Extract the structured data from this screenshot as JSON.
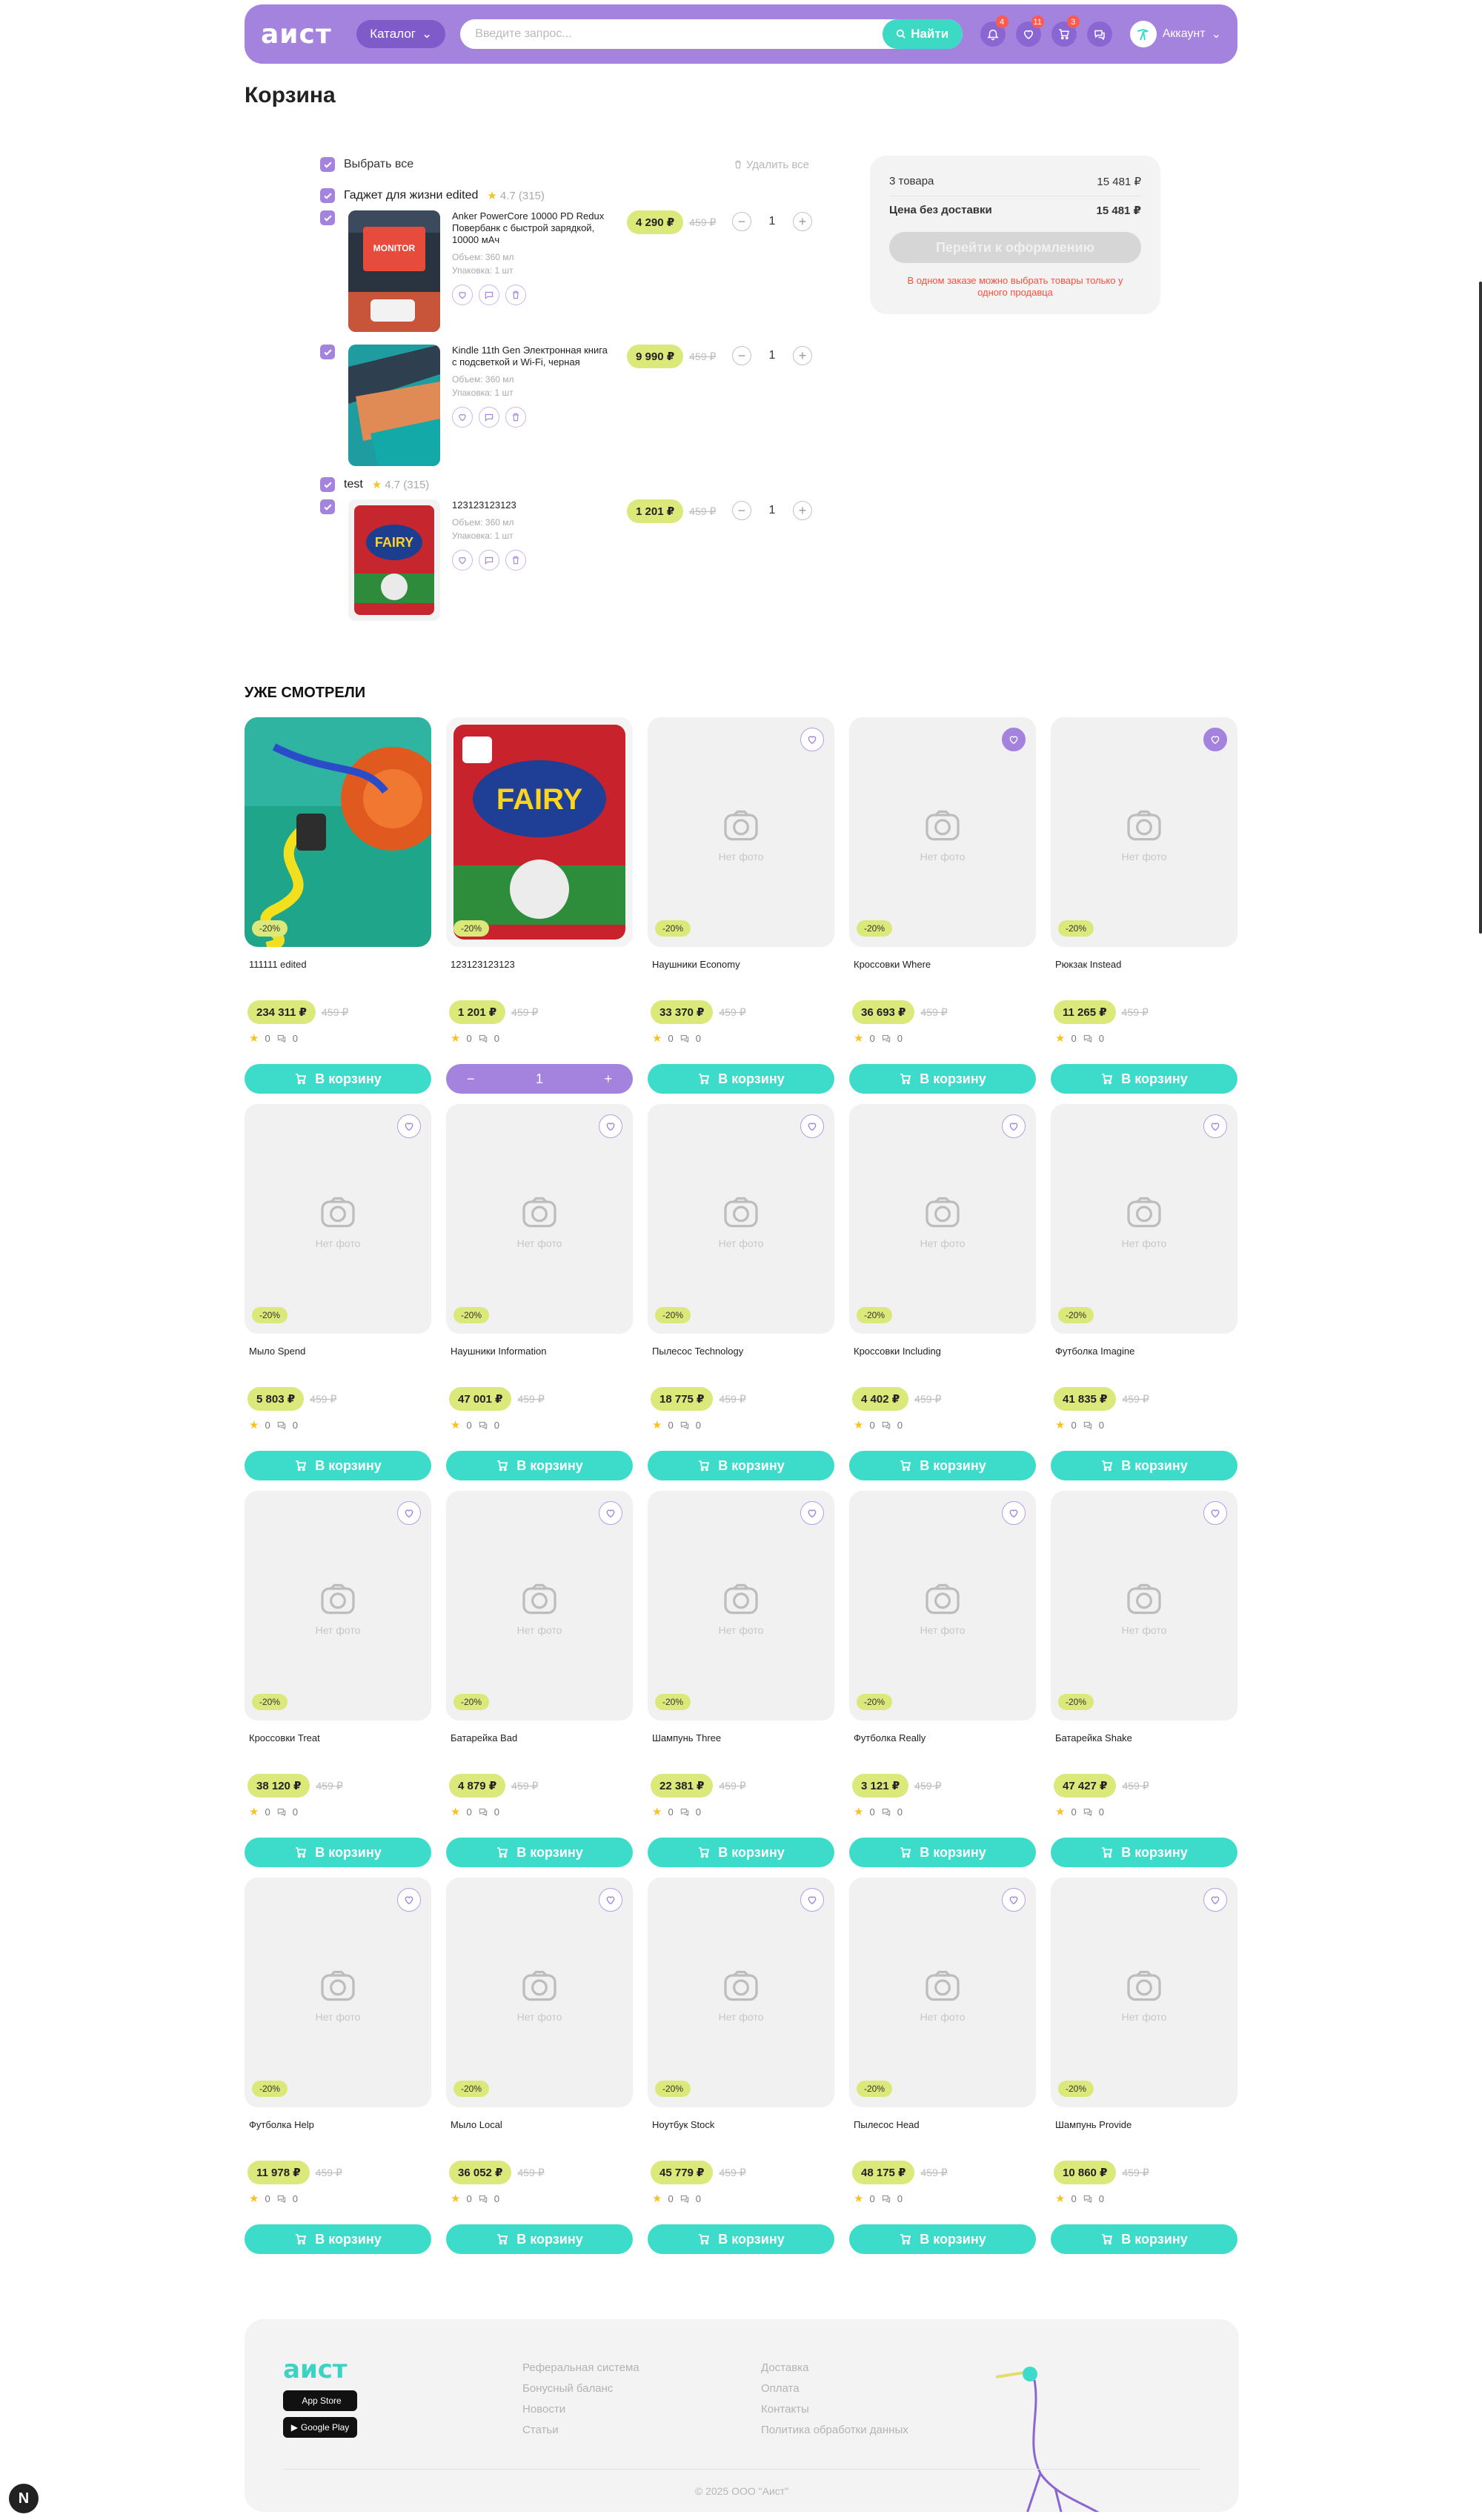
{
  "header": {
    "logo": "аист",
    "catalog": "Каталог",
    "search_placeholder": "Введите запрос...",
    "search_button": "Найти",
    "badges": {
      "notifications": "4",
      "favorites": "11",
      "cart": "3"
    },
    "account": "Аккаунт"
  },
  "page_title": "Корзина",
  "cart": {
    "select_all": "Выбрать все",
    "delete_all": "Удалить все",
    "sellers": [
      {
        "name": "Гаджет для жизни edited",
        "rating": "4.7 (315)",
        "items": [
          {
            "name": "Anker PowerCore 10000 PD Redux Повербанк с быстрой зарядкой, 10000 мАч",
            "volume": "Объем: 360 мл",
            "package": "Упаковка: 1 шт",
            "price": "4 290 ₽",
            "old_price": "459 ₽",
            "qty": "1"
          },
          {
            "name": "Kindle 11th Gen Электронная книга с подсветкой и Wi-Fi, черная",
            "volume": "Объем: 360 мл",
            "package": "Упаковка: 1 шт",
            "price": "9 990 ₽",
            "old_price": "459 ₽",
            "qty": "1"
          }
        ]
      },
      {
        "name": "test",
        "rating": "4.7 (315)",
        "items": [
          {
            "name": "123123123123",
            "volume": "Объем: 360 мл",
            "package": "Упаковка: 1 шт",
            "price": "1 201 ₽",
            "old_price": "459 ₽",
            "qty": "1"
          }
        ]
      }
    ]
  },
  "summary": {
    "items_label": "3 товара",
    "items_total": "15 481 ₽",
    "no_delivery_label": "Цена без доставки",
    "no_delivery_total": "15 481 ₽",
    "checkout": "Перейти к оформлению",
    "warning": "В одном заказе можно выбрать товары только у одного продавца"
  },
  "viewed_title": "УЖЕ СМОТРЕЛИ",
  "viewed": [
    {
      "name": "111111 edited",
      "price": "234 311 ₽",
      "old": "459 ₽",
      "disc": "-20%",
      "rating": "0",
      "reviews": "0",
      "img": "compressor",
      "fav": false,
      "in_cart": false
    },
    {
      "name": "123123123123",
      "price": "1 201 ₽",
      "old": "459 ₽",
      "disc": "-20%",
      "rating": "0",
      "reviews": "0",
      "img": "fairy",
      "fav": false,
      "in_cart": true,
      "qty": "1"
    },
    {
      "name": "Наушники Economy",
      "price": "33 370 ₽",
      "old": "459 ₽",
      "disc": "-20%",
      "rating": "0",
      "reviews": "0",
      "img": "none",
      "fav": false,
      "in_cart": false
    },
    {
      "name": "Кроссовки Where",
      "price": "36 693 ₽",
      "old": "459 ₽",
      "disc": "-20%",
      "rating": "0",
      "reviews": "0",
      "img": "none",
      "fav": true,
      "in_cart": false
    },
    {
      "name": "Рюкзак Instead",
      "price": "11 265 ₽",
      "old": "459 ₽",
      "disc": "-20%",
      "rating": "0",
      "reviews": "0",
      "img": "none",
      "fav": true,
      "in_cart": false
    },
    {
      "name": "Мыло Spend",
      "price": "5 803 ₽",
      "old": "459 ₽",
      "disc": "-20%",
      "rating": "0",
      "reviews": "0",
      "img": "none",
      "fav": false,
      "in_cart": false
    },
    {
      "name": "Наушники Information",
      "price": "47 001 ₽",
      "old": "459 ₽",
      "disc": "-20%",
      "rating": "0",
      "reviews": "0",
      "img": "none",
      "fav": false,
      "in_cart": false
    },
    {
      "name": "Пылесос Technology",
      "price": "18 775 ₽",
      "old": "459 ₽",
      "disc": "-20%",
      "rating": "0",
      "reviews": "0",
      "img": "none",
      "fav": false,
      "in_cart": false
    },
    {
      "name": "Кроссовки Including",
      "price": "4 402 ₽",
      "old": "459 ₽",
      "disc": "-20%",
      "rating": "0",
      "reviews": "0",
      "img": "none",
      "fav": false,
      "in_cart": false
    },
    {
      "name": "Футболка Imagine",
      "price": "41 835 ₽",
      "old": "459 ₽",
      "disc": "-20%",
      "rating": "0",
      "reviews": "0",
      "img": "none",
      "fav": false,
      "in_cart": false
    },
    {
      "name": "Кроссовки Treat",
      "price": "38 120 ₽",
      "old": "459 ₽",
      "disc": "-20%",
      "rating": "0",
      "reviews": "0",
      "img": "none",
      "fav": false,
      "in_cart": false
    },
    {
      "name": "Батарейка Bad",
      "price": "4 879 ₽",
      "old": "459 ₽",
      "disc": "-20%",
      "rating": "0",
      "reviews": "0",
      "img": "none",
      "fav": false,
      "in_cart": false
    },
    {
      "name": "Шампунь Three",
      "price": "22 381 ₽",
      "old": "459 ₽",
      "disc": "-20%",
      "rating": "0",
      "reviews": "0",
      "img": "none",
      "fav": false,
      "in_cart": false
    },
    {
      "name": "Футболка Really",
      "price": "3 121 ₽",
      "old": "459 ₽",
      "disc": "-20%",
      "rating": "0",
      "reviews": "0",
      "img": "none",
      "fav": false,
      "in_cart": false
    },
    {
      "name": "Батарейка Shake",
      "price": "47 427 ₽",
      "old": "459 ₽",
      "disc": "-20%",
      "rating": "0",
      "reviews": "0",
      "img": "none",
      "fav": false,
      "in_cart": false
    },
    {
      "name": "Футболка Help",
      "price": "11 978 ₽",
      "old": "459 ₽",
      "disc": "-20%",
      "rating": "0",
      "reviews": "0",
      "img": "none",
      "fav": false,
      "in_cart": false
    },
    {
      "name": "Мыло Local",
      "price": "36 052 ₽",
      "old": "459 ₽",
      "disc": "-20%",
      "rating": "0",
      "reviews": "0",
      "img": "none",
      "fav": false,
      "in_cart": false
    },
    {
      "name": "Ноутбук Stock",
      "price": "45 779 ₽",
      "old": "459 ₽",
      "disc": "-20%",
      "rating": "0",
      "reviews": "0",
      "img": "none",
      "fav": false,
      "in_cart": false
    },
    {
      "name": "Пылесос Head",
      "price": "48 175 ₽",
      "old": "459 ₽",
      "disc": "-20%",
      "rating": "0",
      "reviews": "0",
      "img": "none",
      "fav": false,
      "in_cart": false
    },
    {
      "name": "Шампунь Provide",
      "price": "10 860 ₽",
      "old": "459 ₽",
      "disc": "-20%",
      "rating": "0",
      "reviews": "0",
      "img": "none",
      "fav": false,
      "in_cart": false
    }
  ],
  "labels": {
    "no_photo": "Нет фото",
    "to_cart": "В корзину"
  },
  "footer": {
    "logo": "аист",
    "app_store": "App Store",
    "google_play": "Google Play",
    "col1": [
      "Реферальная система",
      "Бонусный баланс",
      "Новости",
      "Статьи"
    ],
    "col2": [
      "Доставка",
      "Оплата",
      "Контакты",
      "Политика обработки данных"
    ],
    "copyright": "© 2025 ООО \"Аист\""
  },
  "colors": {
    "brand": "#a383de",
    "accent": "#3ddcca",
    "price": "#dbe87a",
    "warning": "#ff4d3d"
  }
}
